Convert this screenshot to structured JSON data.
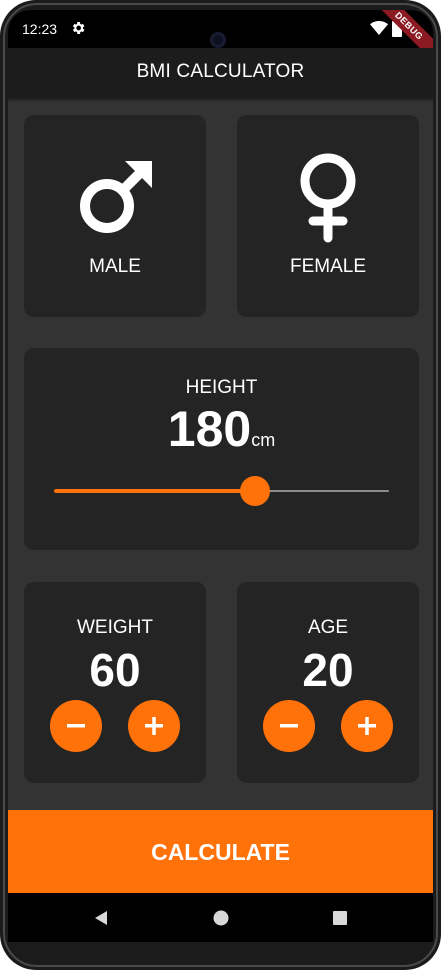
{
  "status_bar": {
    "time": "12:23",
    "debug_banner": "DEBUG"
  },
  "app_bar": {
    "title": "BMI CALCULATOR"
  },
  "gender": {
    "male_label": "MALE",
    "female_label": "FEMALE",
    "male_icon": "male-symbol-icon",
    "female_icon": "female-symbol-icon"
  },
  "height": {
    "label": "HEIGHT",
    "value": "180",
    "unit": "cm",
    "slider_fraction": 0.6
  },
  "weight": {
    "label": "WEIGHT",
    "value": "60"
  },
  "age": {
    "label": "AGE",
    "value": "20"
  },
  "calculate_button": {
    "label": "CALCULATE"
  },
  "colors": {
    "accent": "#ff7109",
    "card": "#242424",
    "background": "#333333",
    "app_bar": "#1c1c1c"
  }
}
